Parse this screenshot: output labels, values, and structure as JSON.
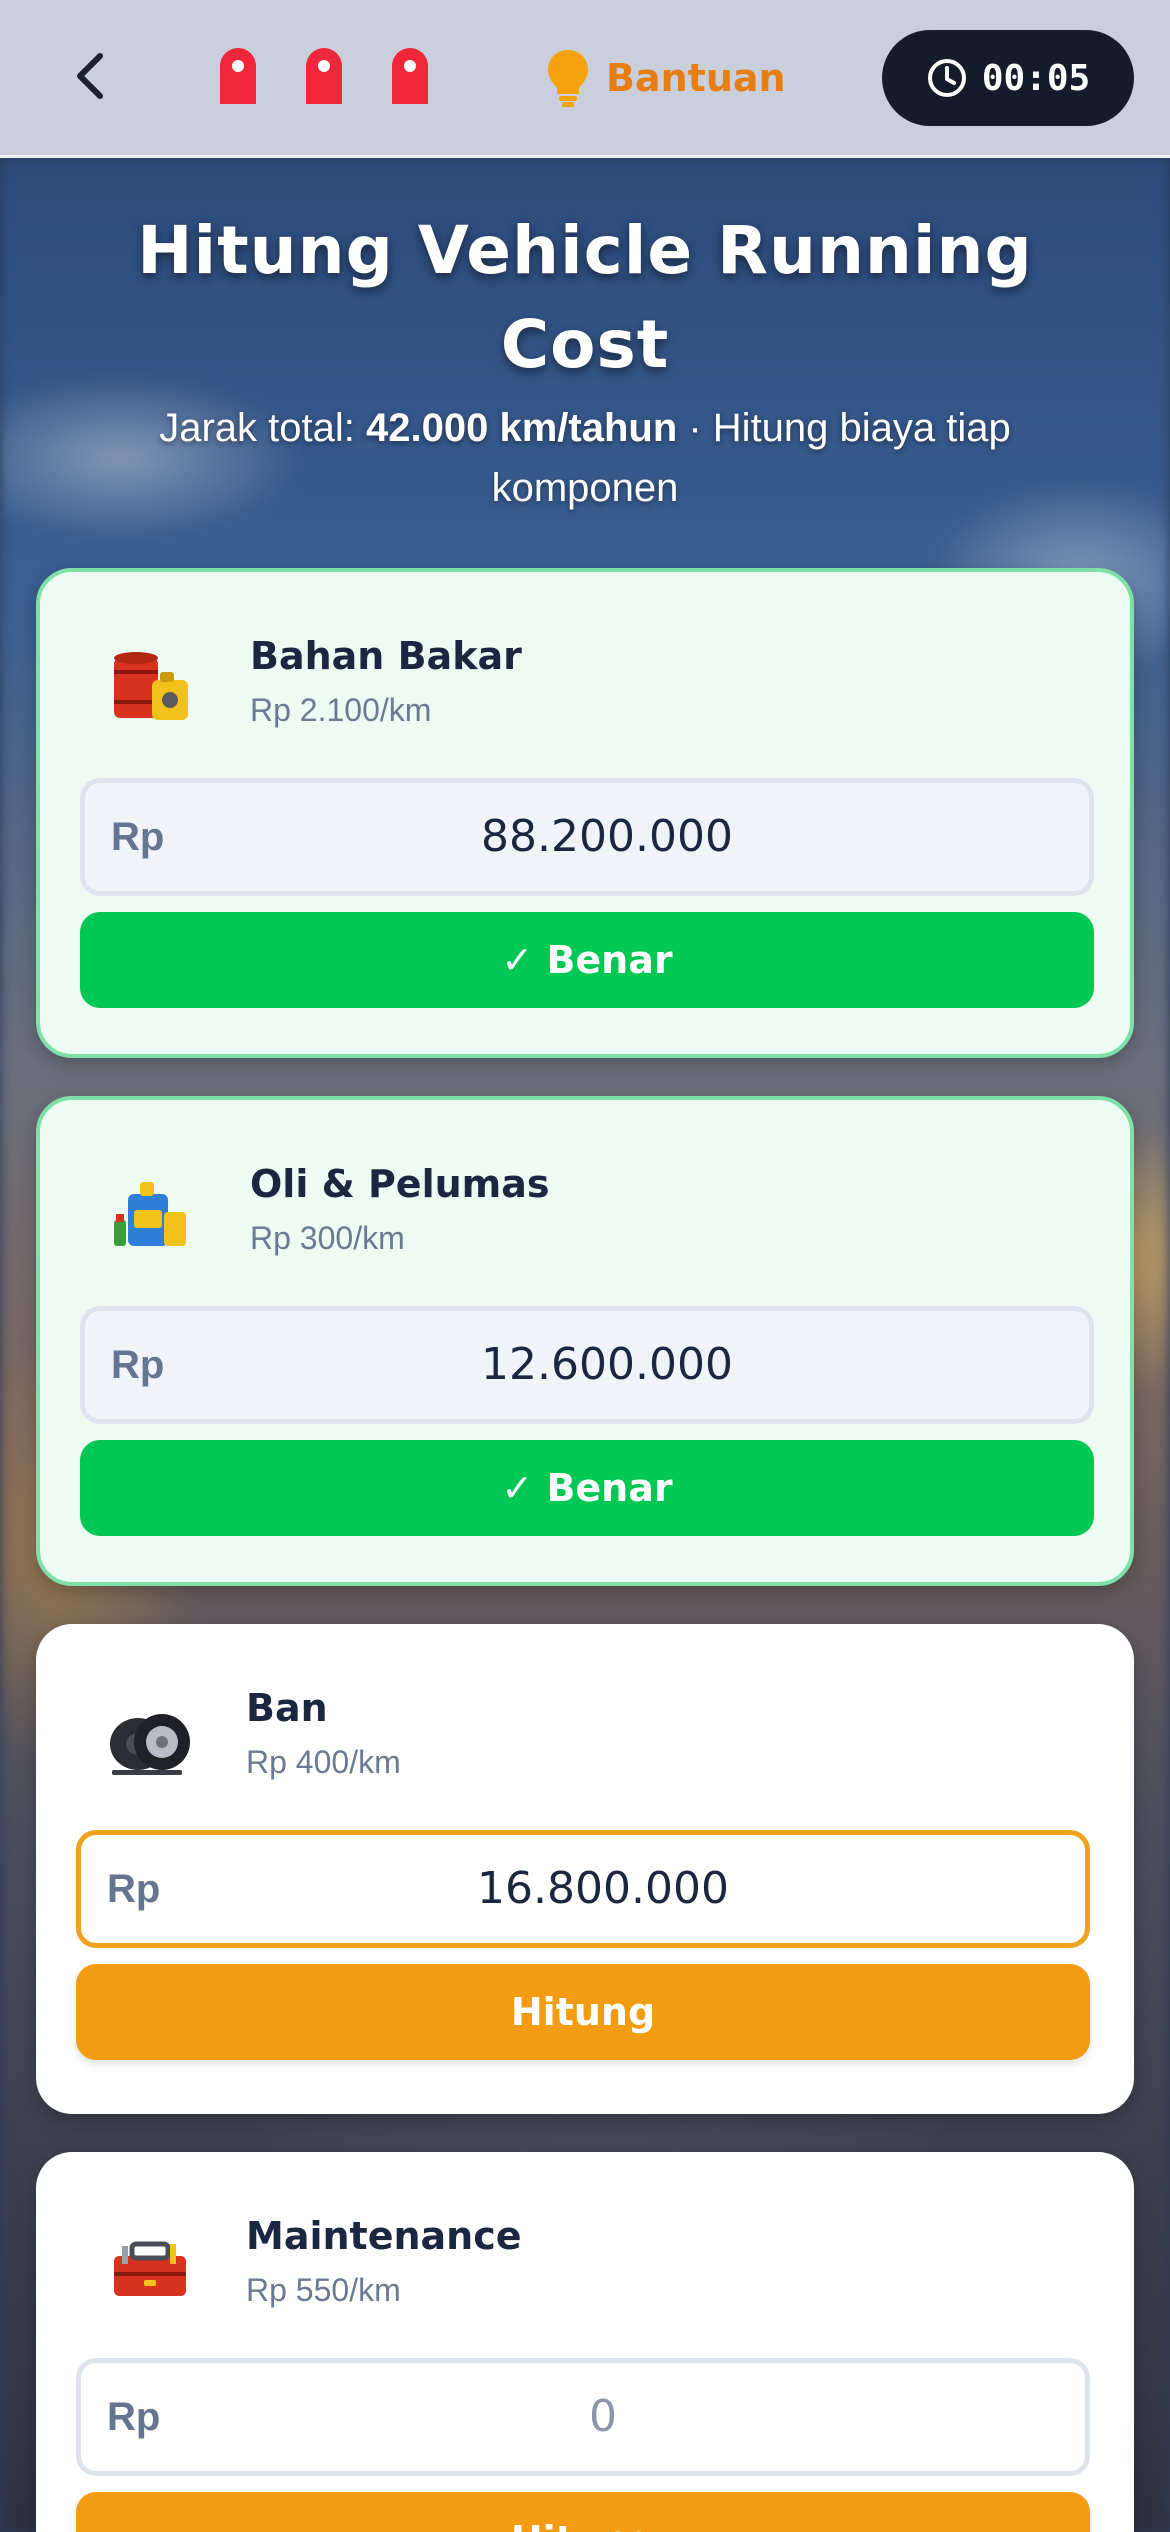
{
  "header": {
    "lives": [
      {
        "icon": "life-marker-icon"
      },
      {
        "icon": "life-marker-icon"
      },
      {
        "icon": "life-marker-icon"
      }
    ],
    "help_label": "Bantuan",
    "help_icon": "lightbulb-icon",
    "timer": "00:05",
    "timer_icon": "clock-icon",
    "accent_color": "#e67e14"
  },
  "title": "Hitung Vehicle Running Cost",
  "subtitle": {
    "prefix": "Jarak total: ",
    "distance": "42.000 km/tahun",
    "separator": " · ",
    "suffix": "Hitung biaya tiap komponen"
  },
  "currency": "Rp",
  "cards": [
    {
      "name": "Bahan Bakar",
      "rate": "Rp 2.100/km",
      "icon": "fuel-barrel-icon",
      "amount": "88.200.000",
      "status": "done",
      "button_label": "✓ Benar"
    },
    {
      "name": "Oli & Pelumas",
      "rate": "Rp 300/km",
      "icon": "oil-bottle-icon",
      "amount": "12.600.000",
      "status": "done",
      "button_label": "✓ Benar"
    },
    {
      "name": "Ban",
      "rate": "Rp 400/km",
      "icon": "tire-icon",
      "amount": "16.800.000",
      "status": "active",
      "button_label": "Hitung"
    },
    {
      "name": "Maintenance",
      "rate": "Rp 550/km",
      "icon": "toolbox-icon",
      "amount": "0",
      "status": "empty",
      "button_label": "Hitung"
    }
  ],
  "colors": {
    "correct": "#00c853",
    "calculate": "#f39c12",
    "done_card": "#edfbf3"
  }
}
